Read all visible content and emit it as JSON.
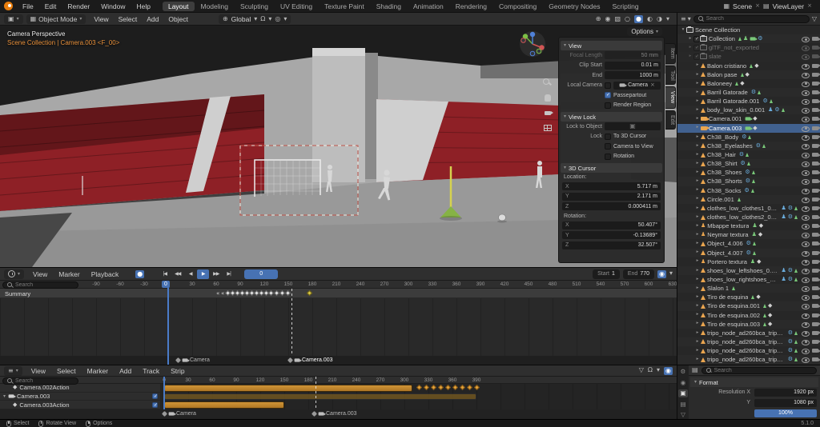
{
  "colors": {
    "accent_blue": "#4772b3",
    "selection_blue": "#41618f",
    "object_orange": "#eaa54f",
    "strip_orange": "#c1872f",
    "stand_red": "#8e2026",
    "marker_yellow": "#d8c84a"
  },
  "topbar": {
    "menus": [
      "File",
      "Edit",
      "Render",
      "Window",
      "Help"
    ],
    "workspaces": [
      "Layout",
      "Modeling",
      "Sculpting",
      "UV Editing",
      "Texture Paint",
      "Shading",
      "Animation",
      "Rendering",
      "Compositing",
      "Geometry Nodes",
      "Scripting"
    ],
    "active_workspace": "Layout",
    "scene_label": "Scene",
    "view_layer_label": "ViewLayer"
  },
  "viewport": {
    "header": {
      "editor_icon": {
        "name": "editor-type-3d-viewport-icon",
        "glyph": "▣"
      },
      "mode": "Object Mode",
      "menus": [
        "View",
        "Select",
        "Add",
        "Object"
      ],
      "orientation": "Global",
      "transform_icons": [
        {
          "name": "orientation-dropdown-icon",
          "glyph": "▾"
        },
        {
          "name": "snap-magnet-icon",
          "glyph": "Ω"
        },
        {
          "name": "snap-dropdown-icon",
          "glyph": "▾"
        },
        {
          "name": "proportional-editing-icon",
          "glyph": "◎"
        },
        {
          "name": "proportional-dropdown-icon",
          "glyph": "▾"
        }
      ],
      "right_icons": [
        {
          "name": "show-gizmo-icon",
          "glyph": "⊕"
        },
        {
          "name": "show-overlays-icon",
          "glyph": "◉"
        },
        {
          "name": "toggle-xray-icon",
          "glyph": "▧"
        },
        {
          "name": "shading-wireframe-icon",
          "glyph": "○"
        },
        {
          "name": "shading-solid-icon",
          "glyph": "●",
          "active": true
        },
        {
          "name": "shading-material-icon",
          "glyph": "◐"
        },
        {
          "name": "shading-rendered-icon",
          "glyph": "◑"
        },
        {
          "name": "shading-options-dropdown-icon",
          "glyph": "▾"
        }
      ]
    },
    "overlay_title": "Camera Perspective",
    "overlay_breadcrumb": "Scene Collection | Camera.003 <F_00>",
    "options_label": "Options"
  },
  "npanel": {
    "tabs": [
      "Item",
      "Tool",
      "View",
      "Edit"
    ],
    "active_tab": "View",
    "view": {
      "title": "View",
      "focal_label": "Focal Length",
      "focal_value": "50 mm",
      "clip_start_label": "Clip Start",
      "clip_start_value": "0.01 m",
      "clip_end_label": "End",
      "clip_end_value": "1000 m",
      "local_camera_label": "Local Camera",
      "local_camera_value": "Camera",
      "passepartout_label": "Passepartout",
      "render_region_label": "Render Region"
    },
    "view_lock": {
      "title": "View Lock",
      "lock_to_object_label": "Lock to Object",
      "lock_label": "Lock",
      "to_3d_cursor_label": "To 3D Cursor",
      "camera_to_view_label": "Camera to View",
      "rotation_label": "Rotation"
    },
    "cursor": {
      "title": "3D Cursor",
      "location_label": "Location:",
      "loc": [
        {
          "axis": "X",
          "value": "5.717 m"
        },
        {
          "axis": "Y",
          "value": "2.171 m"
        },
        {
          "axis": "Z",
          "value": "0.000411 m"
        }
      ],
      "rotation_label": "Rotation:",
      "rot": [
        {
          "axis": "X",
          "value": "50.407°"
        },
        {
          "axis": "Y",
          "value": "-0.13689°"
        },
        {
          "axis": "Z",
          "value": "32.507°"
        }
      ]
    }
  },
  "dopesheet": {
    "menus": [
      "View",
      "Marker",
      "Playback"
    ],
    "search_placeholder": "Search",
    "summary_label": "Summary",
    "keying_icon": {
      "name": "auto-keyframe-icon",
      "glyph": "●",
      "active": true
    },
    "transport": [
      {
        "name": "jump-to-start-icon",
        "glyph": "|◀"
      },
      {
        "name": "previous-keyframe-icon",
        "glyph": "◀◀"
      },
      {
        "name": "play-reverse-icon",
        "glyph": "◀"
      },
      {
        "name": "play-icon",
        "glyph": "▶",
        "active": true
      },
      {
        "name": "next-keyframe-icon",
        "glyph": "▶▶"
      },
      {
        "name": "jump-to-end-icon",
        "glyph": "▶|"
      }
    ],
    "current_frame": "0",
    "start_label": "Start",
    "start_value": "1",
    "end_label": "End",
    "end_value": "770",
    "right_icons": [
      {
        "name": "auto-snap-icon",
        "glyph": "◉",
        "active": true
      },
      {
        "name": "playback-dropdown-icon",
        "glyph": "▾"
      }
    ],
    "ruler": [
      "-90",
      "-60",
      "-30",
      "0",
      "30",
      "60",
      "90",
      "120",
      "150",
      "180",
      "210",
      "240",
      "270",
      "300",
      "330",
      "360",
      "390",
      "420",
      "450",
      "480",
      "510",
      "540",
      "570",
      "600",
      "630"
    ],
    "keyframes": [
      74,
      80,
      86,
      92,
      98,
      104,
      110,
      116,
      122,
      128,
      135,
      142,
      149
    ],
    "key_chevrons": [
      60,
      66
    ],
    "key_selected": 174,
    "markers": [
      {
        "label": "Camera",
        "frame": 14
      },
      {
        "label": "Camera.003",
        "frame": 154,
        "active": true,
        "line": true
      }
    ]
  },
  "nla": {
    "menus": [
      "View",
      "Select",
      "Marker",
      "Add",
      "Track",
      "Strip"
    ],
    "search_placeholder": "Search",
    "right_icons": [
      {
        "name": "filter-icon",
        "glyph": "▽"
      },
      {
        "name": "snap-magnet-icon",
        "glyph": "Ω"
      },
      {
        "name": "snap-dropdown-icon",
        "glyph": "▾"
      },
      {
        "name": "auto-snap-icon",
        "glyph": "◉",
        "active": true
      }
    ],
    "ruler": [
      "0",
      "30",
      "60",
      "90",
      "120",
      "150",
      "180",
      "210",
      "240",
      "270",
      "300",
      "330",
      "360",
      "390"
    ],
    "tracks": [
      {
        "label": "Camera.002Action",
        "type": "action",
        "strip_start": 0,
        "strip_end": 310,
        "keys": [
          318,
          327,
          336,
          345,
          354,
          363,
          372,
          381,
          390
        ]
      },
      {
        "label": "Camera.003",
        "type": "object",
        "strip_start": 0,
        "strip_end": 390,
        "muted": true,
        "checkbox": true
      },
      {
        "label": "Camera.003Action",
        "type": "action",
        "strip_start": 0,
        "strip_end": 150,
        "checkbox": true
      }
    ],
    "markers": [
      {
        "label": "Camera",
        "frame": 2
      },
      {
        "label": "Camera.003",
        "frame": 189,
        "line": true
      }
    ]
  },
  "outliner": {
    "search_placeholder": "Search",
    "header_icons": [
      {
        "name": "editor-type-outliner-icon",
        "glyph": "≡"
      },
      {
        "name": "display-mode-dropdown-icon",
        "glyph": "▾"
      }
    ],
    "filter_icon": {
      "name": "filter-icon",
      "glyph": "▽"
    },
    "items": [
      {
        "label": "Scene Collection",
        "icon": "scene",
        "arrow": "open",
        "indent": 0,
        "hide_toggles": true
      },
      {
        "label": "Collection",
        "icon": "collection",
        "arrow": "closed",
        "indent": 1,
        "checkbox": true,
        "badges": [
          "mesh",
          "armdata",
          "cam",
          "mod"
        ]
      },
      {
        "label": "glTF_not_exported",
        "icon": "collection",
        "arrow": "closed",
        "indent": 1,
        "checkbox": true,
        "dim": true
      },
      {
        "label": "slate",
        "icon": "collection",
        "arrow": "closed",
        "indent": 1,
        "checkbox": true,
        "dim": true
      },
      {
        "label": "Balon cristiano",
        "icon": "mesh",
        "arrow": "closed",
        "indent": 2,
        "badges": [
          "mesh",
          "anim"
        ]
      },
      {
        "label": "Balon pase",
        "icon": "mesh",
        "arrow": "closed",
        "indent": 2,
        "badges": [
          "mesh",
          "anim"
        ]
      },
      {
        "label": "Baloneey",
        "icon": "mesh",
        "arrow": "closed",
        "indent": 2,
        "badges": [
          "mesh",
          "anim"
        ]
      },
      {
        "label": "Barril Gatorade",
        "icon": "mesh",
        "arrow": "closed",
        "indent": 2,
        "badges": [
          "mod",
          "mesh"
        ]
      },
      {
        "label": "Barril Gatorade.001",
        "icon": "mesh",
        "arrow": "closed",
        "indent": 2,
        "badges": [
          "mod",
          "mesh"
        ]
      },
      {
        "label": "body_low_skin_0.001",
        "icon": "mesh",
        "arrow": "closed",
        "indent": 2,
        "badges": [
          "armmod",
          "mod",
          "mesh"
        ]
      },
      {
        "label": "Camera.001",
        "icon": "camera",
        "arrow": "closed",
        "indent": 2,
        "badges": [
          "cam",
          "anim"
        ]
      },
      {
        "label": "Camera.003",
        "icon": "camera",
        "arrow": "closed",
        "indent": 2,
        "badges": [
          "cam",
          "anim"
        ],
        "selected": true
      },
      {
        "label": "Ch38_Body",
        "icon": "mesh",
        "arrow": "closed",
        "indent": 2,
        "badges": [
          "mod",
          "mesh"
        ]
      },
      {
        "label": "Ch38_Eyelashes",
        "icon": "mesh",
        "arrow": "closed",
        "indent": 2,
        "badges": [
          "mod",
          "mesh"
        ]
      },
      {
        "label": "Ch38_Hair",
        "icon": "mesh",
        "arrow": "closed",
        "indent": 2,
        "badges": [
          "mod",
          "mesh"
        ]
      },
      {
        "label": "Ch38_Shirt",
        "icon": "mesh",
        "arrow": "closed",
        "indent": 2,
        "badges": [
          "mod",
          "mesh"
        ]
      },
      {
        "label": "Ch38_Shoes",
        "icon": "mesh",
        "arrow": "closed",
        "indent": 2,
        "badges": [
          "mod",
          "mesh"
        ]
      },
      {
        "label": "Ch38_Shorts",
        "icon": "mesh",
        "arrow": "closed",
        "indent": 2,
        "badges": [
          "mod",
          "mesh"
        ]
      },
      {
        "label": "Ch38_Socks",
        "icon": "mesh",
        "arrow": "closed",
        "indent": 2,
        "badges": [
          "mod",
          "mesh"
        ]
      },
      {
        "label": "Circle.001",
        "icon": "mesh",
        "arrow": "closed",
        "indent": 2,
        "badges": [
          "mesh"
        ]
      },
      {
        "label": "clothes_low_clothes1_0.001",
        "icon": "mesh",
        "arrow": "closed",
        "indent": 2,
        "badges": [
          "armmod",
          "mod",
          "mesh"
        ]
      },
      {
        "label": "clothes_low_clothes2_0.001",
        "icon": "mesh",
        "arrow": "closed",
        "indent": 2,
        "badges": [
          "armmod",
          "mod",
          "mesh"
        ]
      },
      {
        "label": "Mbappe textura",
        "icon": "armature",
        "arrow": "closed",
        "indent": 2,
        "badges": [
          "armdata",
          "anim"
        ]
      },
      {
        "label": "Neymar textura",
        "icon": "armature",
        "arrow": "closed",
        "indent": 2,
        "badges": [
          "armdata",
          "anim"
        ]
      },
      {
        "label": "Object_4.006",
        "icon": "mesh",
        "arrow": "closed",
        "indent": 2,
        "badges": [
          "mod",
          "mesh"
        ]
      },
      {
        "label": "Object_4.007",
        "icon": "mesh",
        "arrow": "closed",
        "indent": 2,
        "badges": [
          "mod",
          "mesh"
        ]
      },
      {
        "label": "Portero textura",
        "icon": "armature",
        "arrow": "closed",
        "indent": 2,
        "badges": [
          "armdata",
          "anim"
        ]
      },
      {
        "label": "shoes_low_leftshoes_0.001",
        "icon": "mesh",
        "arrow": "closed",
        "indent": 2,
        "badges": [
          "armmod",
          "mod",
          "mesh"
        ]
      },
      {
        "label": "shoes_low_rightshoes_0.001",
        "icon": "mesh",
        "arrow": "closed",
        "indent": 2,
        "badges": [
          "armmod",
          "mod",
          "mesh"
        ]
      },
      {
        "label": "Slalon 1",
        "icon": "mesh",
        "arrow": "closed",
        "indent": 2,
        "badges": [
          "mesh"
        ]
      },
      {
        "label": "Tiro de esquina",
        "icon": "mesh",
        "arrow": "closed",
        "indent": 2,
        "badges": [
          "mesh",
          "anim"
        ]
      },
      {
        "label": "Tiro de esquina.001",
        "icon": "mesh",
        "arrow": "closed",
        "indent": 2,
        "badges": [
          "mesh",
          "anim"
        ]
      },
      {
        "label": "Tiro de esquina.002",
        "icon": "mesh",
        "arrow": "closed",
        "indent": 2,
        "badges": [
          "mesh",
          "anim"
        ]
      },
      {
        "label": "Tiro de esquina.003",
        "icon": "mesh",
        "arrow": "closed",
        "indent": 2,
        "badges": [
          "mesh",
          "anim"
        ]
      },
      {
        "label": "tripo_node_ad260bca_tripo_mat_ad26",
        "icon": "mesh",
        "arrow": "closed",
        "indent": 2,
        "badges": [
          "mod",
          "mesh"
        ]
      },
      {
        "label": "tripo_node_ad260bca_tripo_mat_ad26",
        "icon": "mesh",
        "arrow": "closed",
        "indent": 2,
        "badges": [
          "mod",
          "mesh"
        ]
      },
      {
        "label": "tripo_node_ad260bca_tripo_mat_ad26",
        "icon": "mesh",
        "arrow": "closed",
        "indent": 2,
        "badges": [
          "mod",
          "mesh"
        ]
      },
      {
        "label": "tripo_node_ad260bca_tripo_mat_ad26",
        "icon": "mesh",
        "arrow": "closed",
        "indent": 2,
        "badges": [
          "mod",
          "mesh"
        ]
      }
    ]
  },
  "properties": {
    "search_placeholder": "Search",
    "tabs": [
      {
        "name": "tool-tab-icon",
        "glyph": "⚙"
      },
      {
        "name": "render-tab-icon",
        "glyph": "◉"
      },
      {
        "name": "output-tab-icon",
        "glyph": "▣",
        "active": true
      },
      {
        "name": "view-layer-tab-icon",
        "glyph": "▤"
      },
      {
        "name": "scene-tab-icon",
        "glyph": "▽"
      }
    ],
    "format_title": "Format",
    "resolution_x_label": "Resolution X",
    "resolution_x_value": "1920 px",
    "resolution_y_label": "Y",
    "resolution_y_value": "1080 px",
    "resolution_scale": "100%"
  },
  "statusbar": {
    "hints": [
      {
        "mouse": "left",
        "label": "Select"
      },
      {
        "mouse": "middle",
        "label": "Rotate View"
      },
      {
        "mouse": "right",
        "label": "Options"
      }
    ],
    "version": "5.1.0"
  }
}
